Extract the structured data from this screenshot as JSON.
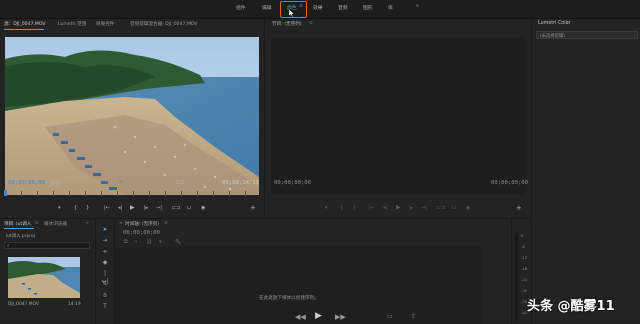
{
  "workspaces": {
    "items": [
      "组件",
      "编辑",
      "颜色",
      "效果",
      "音频",
      "图形",
      "库"
    ],
    "active_index": 2,
    "more": "»"
  },
  "source_panel": {
    "tabs": [
      "源：DJI_0047.MOV",
      "Lumetri 范围",
      "效果控件",
      "音频剪辑混合器: DJI_0047.MOV"
    ],
    "timecode_left": "00;00;00;00",
    "fit": "适合",
    "quality": "1/2",
    "timecode_right": "00;00;14;19"
  },
  "program_panel": {
    "title": "节目: (无序列)",
    "timecode_left": "00;00;00;00",
    "timecode_right": "00;00;00;00"
  },
  "lumetri_panel": {
    "title": "Lumetri Color",
    "dropdown": "(未选择剪辑)"
  },
  "project_panel": {
    "tabs": [
      "项目: lut调入",
      "媒体浏览器"
    ],
    "project_file": "lut调入.prproj",
    "search_placeholder": "",
    "clip_name": "DJI_0047.MOV",
    "clip_duration": "14:19"
  },
  "timeline_panel": {
    "title": "时间轴: (无序列)",
    "timecode": "00;00;00;00",
    "empty_message": "在此处放下媒体以创建序列。"
  },
  "audio_meter": {
    "labels": [
      "0",
      "-6",
      "-12",
      "-18",
      "-24",
      "-30",
      "-36",
      "-42"
    ]
  },
  "watermark": {
    "text": "头条 @酷雾11"
  },
  "colors": {
    "accent_blue": "#3a86d8",
    "highlight_orange": "#e0602a"
  }
}
